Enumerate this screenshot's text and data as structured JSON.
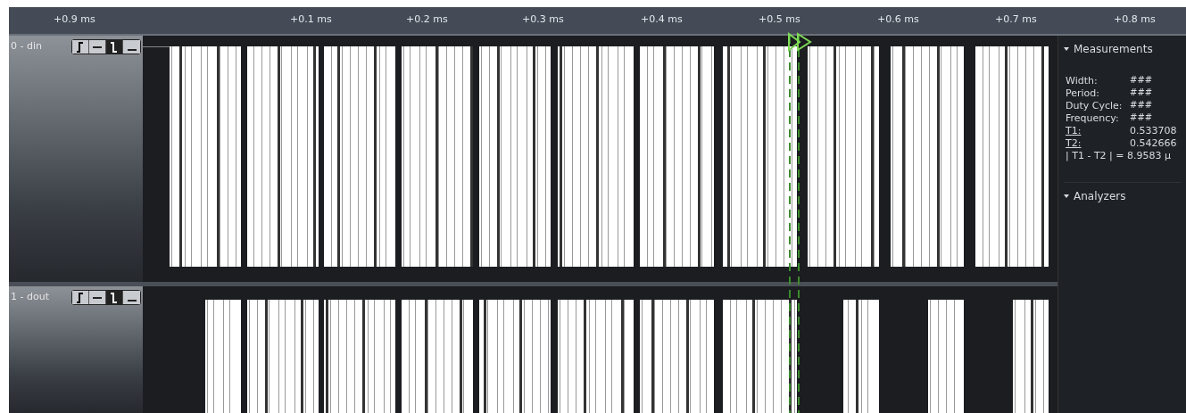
{
  "ruler": {
    "ticks": [
      {
        "label": "+0.9 ms",
        "kind": "labeled"
      },
      {
        "label": "+0.1 ms",
        "kind": "labeled"
      },
      {
        "label": "+0.2 ms",
        "kind": "labeled"
      },
      {
        "label": "+0.3 ms",
        "kind": "labeled"
      },
      {
        "label": "+0.4 ms",
        "kind": "labeled"
      },
      {
        "label": "+0.5 ms",
        "kind": "labeled"
      },
      {
        "label": "+0.6 ms",
        "kind": "labeled"
      },
      {
        "label": "+0.7 ms",
        "kind": "labeled"
      },
      {
        "label": "+0.8 ms",
        "kind": "labeled"
      }
    ]
  },
  "channels": [
    {
      "label": "0 - din"
    },
    {
      "label": "1 - dout"
    }
  ],
  "sidebar": {
    "sections": [
      {
        "title": "Measurements",
        "expanded": true,
        "rows": [
          {
            "label": "Width:",
            "value": "###",
            "underlined": false
          },
          {
            "label": "Period:",
            "value": "###",
            "underlined": false
          },
          {
            "label": "Duty Cycle:",
            "value": "###",
            "underlined": false
          },
          {
            "label": "Frequency:",
            "value": "###",
            "underlined": false
          },
          {
            "label": "T1:",
            "value": "0.533708",
            "underlined": true
          },
          {
            "label": "T2:",
            "value": "0.542666",
            "underlined": true
          }
        ],
        "footer": "| T1 - T2 | = 8.9583 µ"
      },
      {
        "title": "Analyzers",
        "expanded": true
      }
    ]
  }
}
